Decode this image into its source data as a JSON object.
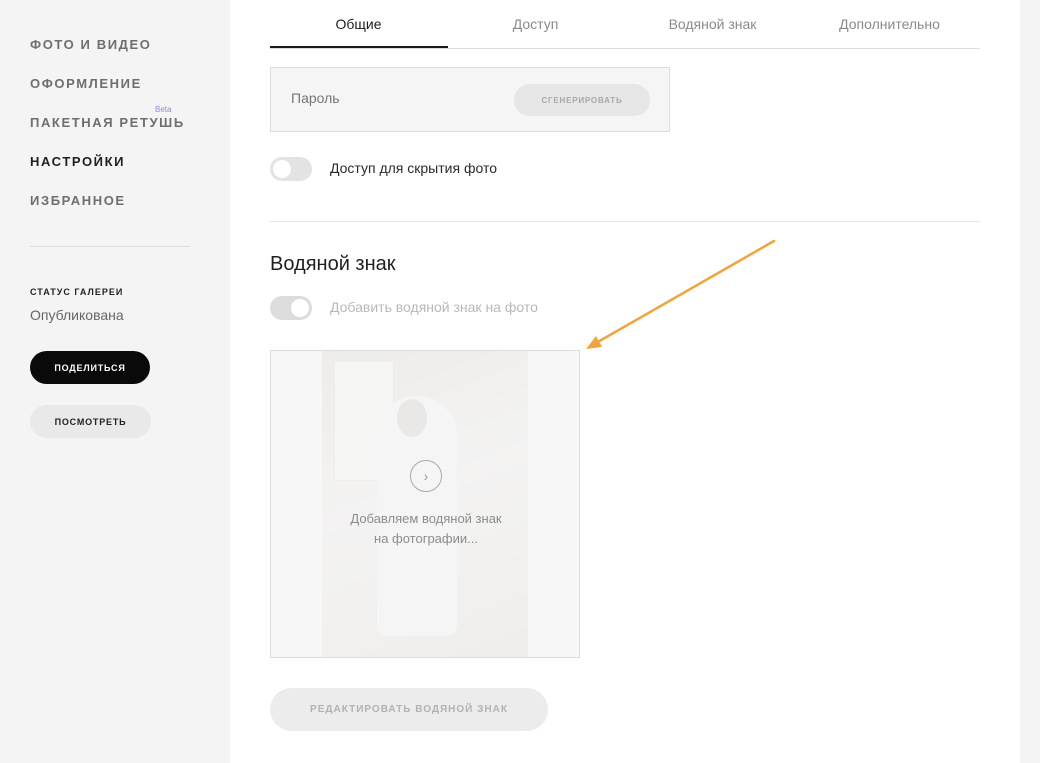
{
  "sidebar": {
    "items": [
      {
        "label": "ФОТО И ВИДЕО",
        "active": false
      },
      {
        "label": "ОФОРМЛЕНИЕ",
        "active": false
      },
      {
        "label": "ПАКЕТНАЯ РЕТУШЬ",
        "active": false
      },
      {
        "label": "НАСТРОЙКИ",
        "active": true
      },
      {
        "label": "ИЗБРАННОЕ",
        "active": false
      }
    ],
    "beta_badge": "Beta",
    "status_title": "СТАТУС ГАЛЕРЕИ",
    "status_value": "Опубликована",
    "share_label": "ПОДЕЛИТЬСЯ",
    "view_label": "ПОСМОТРЕТЬ"
  },
  "tabs": [
    {
      "label": "Общие",
      "active": true
    },
    {
      "label": "Доступ",
      "active": false
    },
    {
      "label": "Водяной знак",
      "active": false
    },
    {
      "label": "Дополнительно",
      "active": false
    }
  ],
  "password": {
    "placeholder": "Пароль",
    "generate_label": "СГЕНЕРИРОВАТЬ"
  },
  "hide_access": {
    "label": "Доступ для скрытия фото",
    "enabled": false
  },
  "watermark": {
    "title": "Водяной знак",
    "toggle_label": "Добавить водяной знак на фото",
    "toggle_enabled": true,
    "toggle_disabled_look": true,
    "preview_text_line1": "Добавляем водяной знак",
    "preview_text_line2": "на фотографии...",
    "edit_label": "РЕДАКТИРОВАТЬ ВОДЯНОЙ ЗНАК"
  },
  "colors": {
    "accent_arrow": "#f0a43a",
    "primary_button": "#0a0a0a",
    "beta": "#9b87d8"
  },
  "icons": {
    "spinner": "loading-spinner-icon",
    "arrow": "annotation-arrow"
  }
}
